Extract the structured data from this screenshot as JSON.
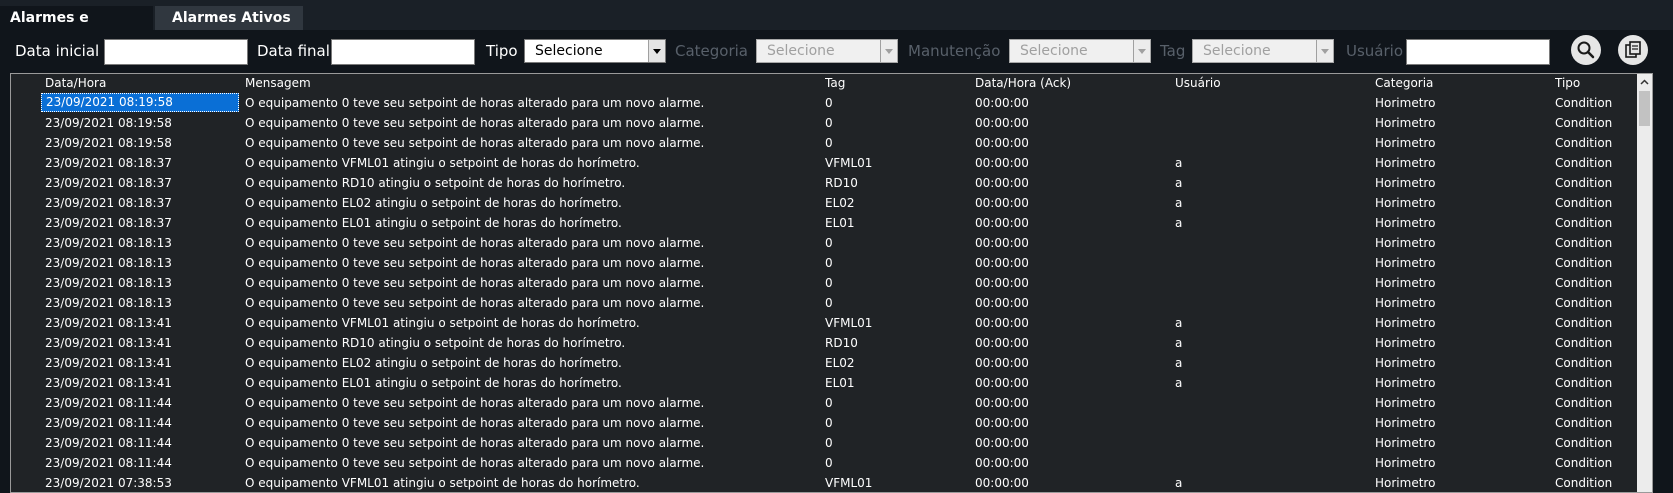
{
  "tabs": [
    {
      "label": "Alarmes e Eventos",
      "active": true
    },
    {
      "label": "Alarmes Ativos",
      "active": false
    }
  ],
  "filters": {
    "data_inicial_label": "Data inicial",
    "data_inicial_value": "",
    "data_final_label": "Data final",
    "data_final_value": "",
    "tipo_label": "Tipo",
    "tipo_value": "Selecione",
    "categoria_label": "Categoria",
    "categoria_value": "Selecione",
    "manutencao_label": "Manutenção",
    "manutencao_value": "Selecione",
    "tag_label": "Tag",
    "tag_value": "Selecione",
    "usuario_label": "Usuário",
    "usuario_value": ""
  },
  "actions": {
    "search_icon": "search-icon",
    "copy_icon": "copy-document-icon"
  },
  "table": {
    "columns": [
      "Data/Hora",
      "Mensagem",
      "Tag",
      "Data/Hora (Ack)",
      "Usuário",
      "Categoria",
      "Tipo"
    ],
    "selected_row": 0,
    "rows": [
      [
        "23/09/2021 08:19:58",
        "O equipamento 0 teve seu setpoint de horas alterado para um novo alarme.",
        "0",
        "00:00:00",
        "",
        "Horimetro",
        "Condition"
      ],
      [
        "23/09/2021 08:19:58",
        "O equipamento 0 teve seu setpoint de horas alterado para um novo alarme.",
        "0",
        "00:00:00",
        "",
        "Horimetro",
        "Condition"
      ],
      [
        "23/09/2021 08:19:58",
        "O equipamento 0 teve seu setpoint de horas alterado para um novo alarme.",
        "0",
        "00:00:00",
        "",
        "Horimetro",
        "Condition"
      ],
      [
        "23/09/2021 08:18:37",
        "O equipamento VFML01 atingiu o setpoint de horas do horímetro.",
        "VFML01",
        "00:00:00",
        "a",
        "Horimetro",
        "Condition"
      ],
      [
        "23/09/2021 08:18:37",
        "O equipamento RD10 atingiu o setpoint de horas do horímetro.",
        "RD10",
        "00:00:00",
        "a",
        "Horimetro",
        "Condition"
      ],
      [
        "23/09/2021 08:18:37",
        "O equipamento EL02 atingiu o setpoint de horas do horímetro.",
        "EL02",
        "00:00:00",
        "a",
        "Horimetro",
        "Condition"
      ],
      [
        "23/09/2021 08:18:37",
        "O equipamento EL01 atingiu o setpoint de horas do horímetro.",
        "EL01",
        "00:00:00",
        "a",
        "Horimetro",
        "Condition"
      ],
      [
        "23/09/2021 08:18:13",
        "O equipamento 0 teve seu setpoint de horas alterado para um novo alarme.",
        "0",
        "00:00:00",
        "",
        "Horimetro",
        "Condition"
      ],
      [
        "23/09/2021 08:18:13",
        "O equipamento 0 teve seu setpoint de horas alterado para um novo alarme.",
        "0",
        "00:00:00",
        "",
        "Horimetro",
        "Condition"
      ],
      [
        "23/09/2021 08:18:13",
        "O equipamento 0 teve seu setpoint de horas alterado para um novo alarme.",
        "0",
        "00:00:00",
        "",
        "Horimetro",
        "Condition"
      ],
      [
        "23/09/2021 08:18:13",
        "O equipamento 0 teve seu setpoint de horas alterado para um novo alarme.",
        "0",
        "00:00:00",
        "",
        "Horimetro",
        "Condition"
      ],
      [
        "23/09/2021 08:13:41",
        "O equipamento VFML01 atingiu o setpoint de horas do horímetro.",
        "VFML01",
        "00:00:00",
        "a",
        "Horimetro",
        "Condition"
      ],
      [
        "23/09/2021 08:13:41",
        "O equipamento RD10 atingiu o setpoint de horas do horímetro.",
        "RD10",
        "00:00:00",
        "a",
        "Horimetro",
        "Condition"
      ],
      [
        "23/09/2021 08:13:41",
        "O equipamento EL02 atingiu o setpoint de horas do horímetro.",
        "EL02",
        "00:00:00",
        "a",
        "Horimetro",
        "Condition"
      ],
      [
        "23/09/2021 08:13:41",
        "O equipamento EL01 atingiu o setpoint de horas do horímetro.",
        "EL01",
        "00:00:00",
        "a",
        "Horimetro",
        "Condition"
      ],
      [
        "23/09/2021 08:11:44",
        "O equipamento 0 teve seu setpoint de horas alterado para um novo alarme.",
        "0",
        "00:00:00",
        "",
        "Horimetro",
        "Condition"
      ],
      [
        "23/09/2021 08:11:44",
        "O equipamento 0 teve seu setpoint de horas alterado para um novo alarme.",
        "0",
        "00:00:00",
        "",
        "Horimetro",
        "Condition"
      ],
      [
        "23/09/2021 08:11:44",
        "O equipamento 0 teve seu setpoint de horas alterado para um novo alarme.",
        "0",
        "00:00:00",
        "",
        "Horimetro",
        "Condition"
      ],
      [
        "23/09/2021 08:11:44",
        "O equipamento 0 teve seu setpoint de horas alterado para um novo alarme.",
        "0",
        "00:00:00",
        "",
        "Horimetro",
        "Condition"
      ],
      [
        "23/09/2021 07:38:53",
        "O equipamento VFML01 atingiu o setpoint de horas do horímetro.",
        "VFML01",
        "00:00:00",
        "a",
        "Horimetro",
        "Condition"
      ]
    ]
  }
}
